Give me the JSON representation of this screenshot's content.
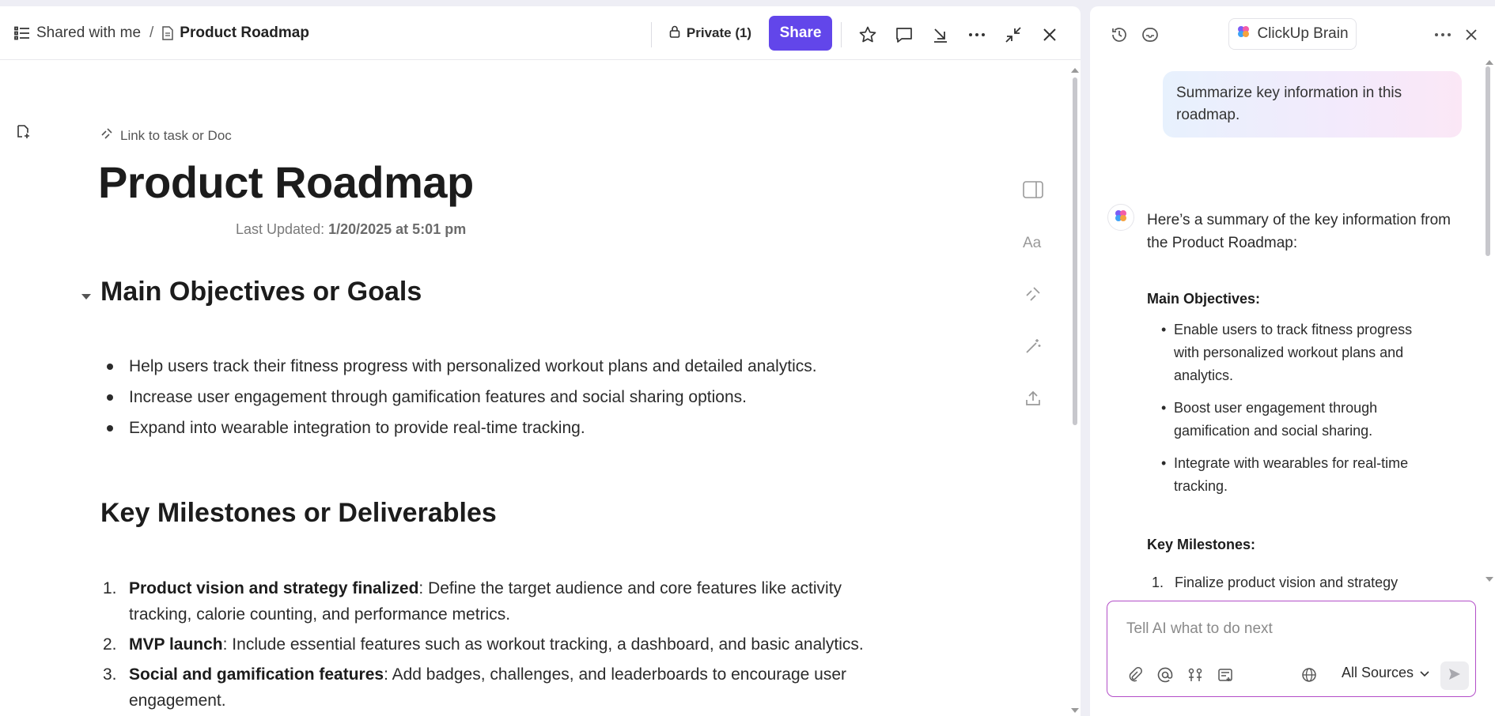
{
  "breadcrumb": {
    "parent": "Shared with me",
    "separator": "/",
    "current": "Product Roadmap"
  },
  "toolbar": {
    "private_label": "Private (1)",
    "share_label": "Share"
  },
  "doc": {
    "link_label": "Link to task or Doc",
    "title": "Product Roadmap",
    "last_updated_label": "Last Updated:",
    "last_updated_value": "1/20/2025 at 5:01 pm",
    "section1_title": "Main Objectives or Goals",
    "goals": [
      "Help users track their fitness progress with personalized workout plans and detailed analytics.",
      "Increase user engagement through gamification features and social sharing options.",
      "Expand into wearable integration to provide real-time tracking."
    ],
    "section2_title": "Key Milestones or Deliverables",
    "milestones": [
      {
        "num": "1.",
        "bold": "Product vision and strategy finalized",
        "text": ": Define the target audience and core features like activity tracking, calorie counting, and performance metrics."
      },
      {
        "num": "2.",
        "bold": "MVP launch",
        "text": ": Include essential features such as workout tracking, a dashboard, and basic analytics."
      },
      {
        "num": "3.",
        "bold": "Social and gamification features",
        "text": ": Add badges, challenges, and leaderboards to encourage user engagement."
      }
    ]
  },
  "ai": {
    "brand": "ClickUp Brain",
    "user_prompt": "Summarize key information in this roadmap.",
    "response_intro": "Here’s a summary of the key information from the Product Roadmap:",
    "objectives_heading": "Main Objectives:",
    "objectives": [
      "Enable users to track fitness progress with personalized workout plans and analytics.",
      "Boost user engagement through gamification and social sharing.",
      "Integrate with wearables for real-time tracking."
    ],
    "milestones_heading": "Key Milestones:",
    "milestone_first_num": "1.",
    "milestone_first": "Finalize product vision and strategy",
    "input_placeholder": "Tell AI what to do next",
    "sources_label": "All Sources"
  },
  "colors": {
    "share_button": "#6246ea",
    "input_border": "#b34ec8"
  }
}
